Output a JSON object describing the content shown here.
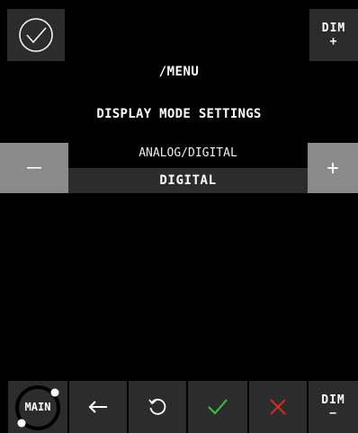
{
  "header": {
    "confirm_icon": "check-circle-icon",
    "dim_up": {
      "top": "DIM",
      "bottom": "+"
    }
  },
  "menu_path": "/MENU",
  "section_title": "DISPLAY MODE SETTINGS",
  "setting": {
    "label": "ANALOG/DIGITAL",
    "value": "DIGITAL",
    "decrement_label": "−",
    "increment_label": "+"
  },
  "toolbar": {
    "main_label": "MAIN",
    "back_icon": "arrow-left-icon",
    "reset_icon": "rotate-ccw-icon",
    "ok_icon": "check-icon",
    "cancel_icon": "x-icon",
    "dim_down": {
      "top": "DIM",
      "bottom": "−"
    }
  },
  "colors": {
    "button_dark": "#2c2c2c",
    "button_light": "#8a8a8a",
    "ok_green": "#3cc43c",
    "cancel_red": "#d42a2a"
  }
}
